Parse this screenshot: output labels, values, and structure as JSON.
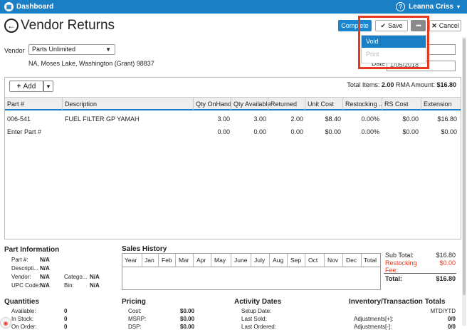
{
  "topbar": {
    "home_label": "Dashboard",
    "user_name": "Leanna Criss"
  },
  "header": {
    "title": "Vendor Returns",
    "complete_label": "Complete",
    "save_label": "Save",
    "more_label": "•••",
    "cancel_label": "Cancel"
  },
  "menu": {
    "void_label": "Void",
    "print_label": "Print"
  },
  "vendor": {
    "label": "Vendor",
    "selected": "Parts Unlimited",
    "address": "NA, Moses Lake, Washington (Grant) 98837",
    "date_label": "Date",
    "date_value": "1/05/2018"
  },
  "items": {
    "add_label": "Add",
    "total_items_label": "Total Items:",
    "total_items_value": "2.00",
    "rma_label": "RMA Amount:",
    "rma_value": "$16.80",
    "columns": [
      "Part #",
      "Description",
      "Qty OnHand",
      "Qty Available",
      "Returned",
      "Unit Cost",
      "Restocking ...",
      "RS Cost",
      "Extension"
    ],
    "rows": [
      [
        "006-541",
        "FUEL FILTER GP YAMAH",
        "3.00",
        "3.00",
        "2.00",
        "$8.40",
        "0.00%",
        "$0.00",
        "$16.80"
      ],
      [
        "Enter Part #",
        "",
        "0.00",
        "0.00",
        "0.00",
        "$0.00",
        "0.00%",
        "$0.00",
        "$0.00"
      ]
    ]
  },
  "part_info": {
    "title": "Part Information",
    "part_label": "Part #:",
    "part_value": "N/A",
    "desc_label": "Descripti...",
    "desc_value": "N/A",
    "vendor_label": "Vendor:",
    "vendor_value": "N/A",
    "category_label": "Catego...",
    "category_value": "N/A",
    "upc_label": "UPC Code:",
    "upc_value": "N/A",
    "bin_label": "Bin:",
    "bin_value": "N/A"
  },
  "sales_history": {
    "title": "Sales History",
    "columns": [
      "Year",
      "Jan",
      "Feb",
      "Mar",
      "Apr",
      "May",
      "June",
      "July",
      "Aug",
      "Sep",
      "Oct",
      "Nov",
      "Dec",
      "Total"
    ]
  },
  "summary": {
    "subtotal_label": "Sub Total:",
    "subtotal_value": "$16.80",
    "restocking_label": "Restocking Fee:",
    "restocking_value": "$0.00",
    "total_label": "Total:",
    "total_value": "$16.80"
  },
  "quantities": {
    "title": "Quantities",
    "available_label": "Available:",
    "available_value": "0",
    "instock_label": "In Stock:",
    "instock_value": "0",
    "onorder_label": "On Order:",
    "onorder_value": "0"
  },
  "pricing": {
    "title": "Pricing",
    "cost_label": "Cost:",
    "cost_value": "$0.00",
    "msrp_label": "MSRP:",
    "msrp_value": "$0.00",
    "dsp_label": "DSP:",
    "dsp_value": "$0.00"
  },
  "activity": {
    "title": "Activity Dates",
    "setup_label": "Setup Date:",
    "lastsold_label": "Last Sold:",
    "lastordered_label": "Last Ordered:"
  },
  "inventory": {
    "title": "Inventory/Transaction Totals",
    "mtd_label": "MTD/YTD",
    "adj_plus_label": "Adjustments[+]:",
    "adj_plus_value": "0/0",
    "adj_minus_label": "Adjustments[-]:",
    "adj_minus_value": "0/0"
  },
  "colors": {
    "accent": "#1a7fc4",
    "highlight": "#e8381e",
    "warning_text": "#e8381e"
  }
}
